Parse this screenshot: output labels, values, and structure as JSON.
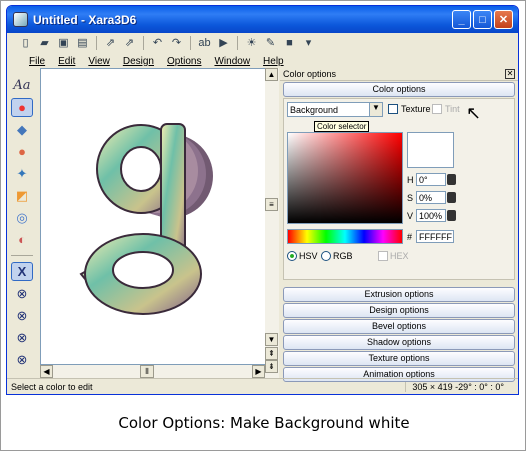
{
  "window": {
    "title": "Untitled - Xara3D6"
  },
  "menu": [
    "File",
    "Edit",
    "View",
    "Design",
    "Options",
    "Window",
    "Help"
  ],
  "panel": {
    "header": "Color options",
    "active_section": "Color options",
    "dropdown_value": "Background",
    "texture_label": "Texture",
    "tint_label": "Tint",
    "tooltip": "Color selector",
    "h_label": "H",
    "h_value": "0°",
    "s_label": "S",
    "s_value": "0%",
    "v_label": "V",
    "v_value": "100%",
    "hex_label": "#",
    "hex_value": "FFFFFF",
    "hsv_label": "HSV",
    "rgb_label": "RGB",
    "hex_cb_label": "HEX",
    "sections": [
      "Extrusion options",
      "Design options",
      "Bevel options",
      "Shadow options",
      "Texture options",
      "Animation options"
    ]
  },
  "status": {
    "left": "Select a color to edit",
    "right": "305 × 419  -29° : 0° : 0°"
  },
  "caption": "Color Options: Make Background white",
  "colors": {
    "accent": "#0a5ee8",
    "swatch": "#ffffff"
  }
}
